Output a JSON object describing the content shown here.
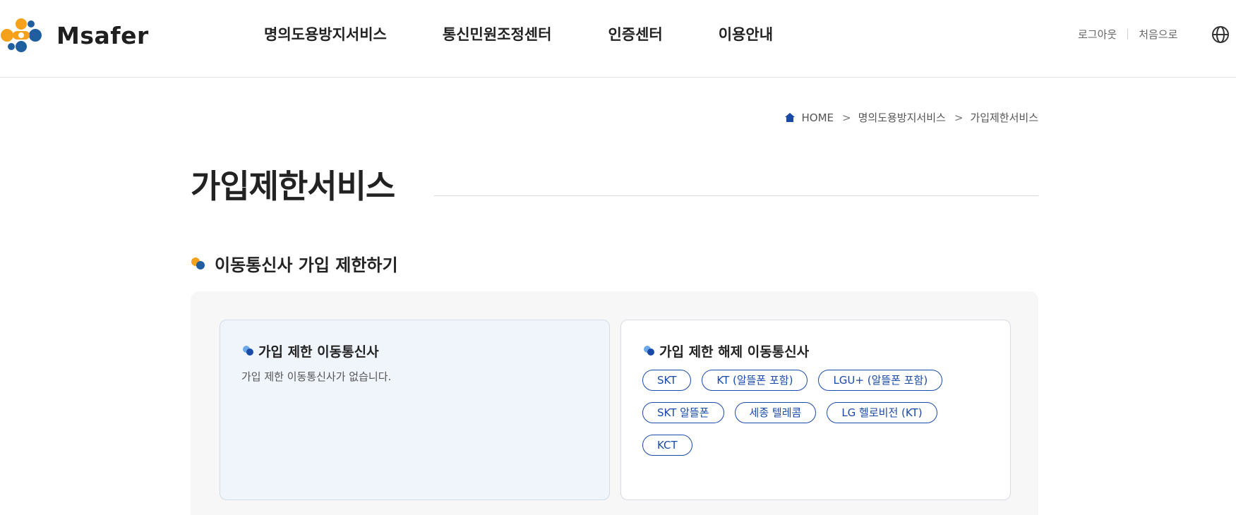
{
  "header": {
    "logo_text": "Msafer",
    "nav": [
      "명의도용방지서비스",
      "통신민원조정센터",
      "인증센터",
      "이용안내"
    ],
    "util": {
      "logout": "로그아웃",
      "home": "처음으로"
    }
  },
  "breadcrumb": {
    "home": "HOME",
    "level1": "명의도용방지서비스",
    "level2": "가입제한서비스"
  },
  "page": {
    "title": "가입제한서비스"
  },
  "section": {
    "title": "이동통신사 가입 제한하기",
    "restricted": {
      "title": "가입 제한 이동통신사",
      "empty_message": "가입 제한 이동통신사가 없습니다."
    },
    "released": {
      "title": "가입 제한 해제 이동통신사",
      "carriers": [
        "SKT",
        "KT (알뜰폰 포함)",
        "LGU+ (알뜰폰 포함)",
        "SKT 알뜰폰",
        "세종 텔레콤",
        "LG 헬로비전 (KT)",
        "KCT"
      ]
    }
  },
  "colors": {
    "brand_orange": "#f5a11c",
    "brand_blue": "#1f5fa0",
    "accent_blue": "#1a4aa8",
    "light_blue": "#6aa8e8"
  },
  "icons": {
    "home": "home-icon",
    "globe": "globe-icon",
    "logo": "msafer-logo-icon"
  }
}
